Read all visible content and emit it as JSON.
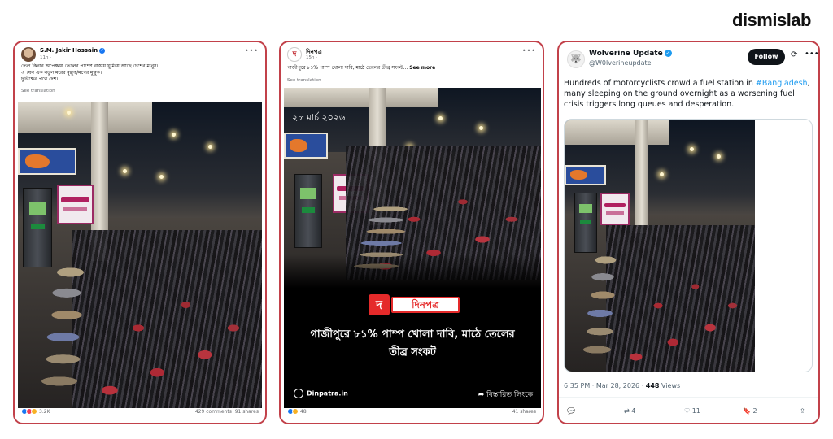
{
  "brand": "dismislab",
  "card1": {
    "author": "S.M. Jakir Hossain",
    "time": "11h ·",
    "lines": [
      "তেল কিনার অপেক্ষায় তেলের পাম্পে রাস্তায় ঘুমিয়ে আছে দেশের মানুষ।",
      "এ যেন এক নতুন মরের মুল্লুক/মগের মুল্লুক।",
      "দুর্ভিক্ষের পথে দেশ।"
    ],
    "see_translation": "See translation",
    "reactions": "3.2K",
    "comments": "429 comments",
    "shares": "91 shares"
  },
  "card2": {
    "page": "দিনপত্র",
    "time": "15h ·",
    "caption": "গাজীপুরে ৮১% পাম্প খোলা দাবি, মাঠে তেলের তীব্র সংকট...",
    "see_more": "See more",
    "see_translation": "See translation",
    "date_overlay": "২৮ মার্চ ২০২৬",
    "logo_letter": "দ",
    "logo_word": "দিনপত্র",
    "headline1": "গাজীপুরে ৮১% পাম্প খোলা দাবি, মাঠে তেলের",
    "headline2": "তীব্র সংকট",
    "site": "Dinpatra.in",
    "detail": "বিস্তারিত লিংকে",
    "reactions": "48",
    "shares": "41 shares"
  },
  "card3": {
    "name": "Wolverine Update",
    "handle": "@W0lverineupdate",
    "follow": "Follow",
    "text_before": "Hundreds of motorcyclists crowd a fuel station in ",
    "hashtag": "#Bangladesh",
    "text_after": ", many sleeping on the ground overnight as a worsening fuel crisis triggers long queues and desperation.",
    "time": "6:35 PM · Mar 28, 2026 · ",
    "views_num": "448",
    "views_label": " Views",
    "retweets": "4",
    "likes": "11",
    "bookmarks": "2"
  },
  "colors": {
    "card_border": "#c2414a",
    "fb_blue": "#1877f2",
    "x_link": "#1d9bf0",
    "dinpatra_red": "#e52a2a"
  }
}
